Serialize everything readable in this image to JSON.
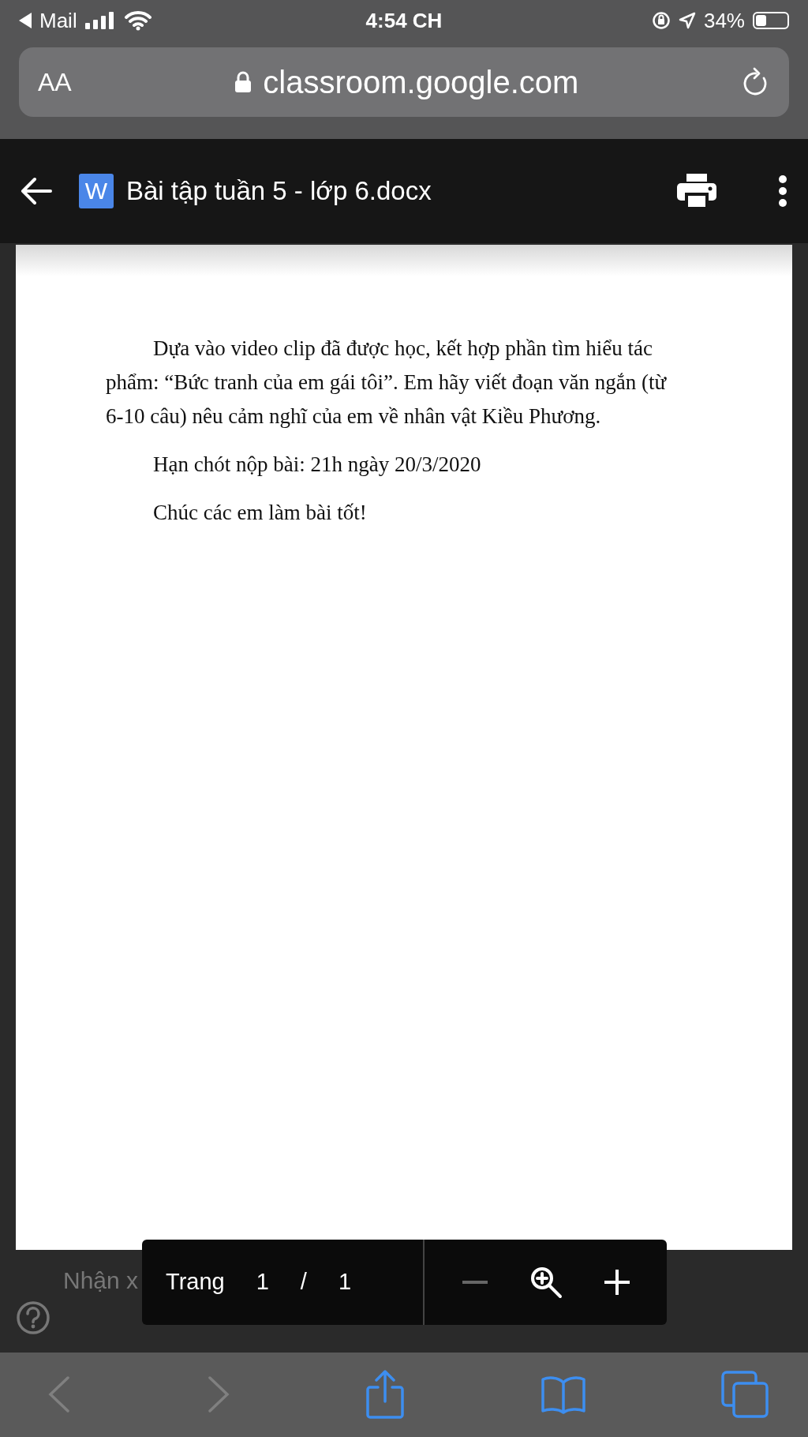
{
  "status_bar": {
    "back_app": "Mail",
    "time": "4:54 CH",
    "battery": "34%"
  },
  "url_bar": {
    "text_size": "AA",
    "url": "classroom.google.com"
  },
  "header": {
    "file_title": "Bài tập tuần 5 - lớp 6.docx",
    "app_badge": "W"
  },
  "document": {
    "paragraphs": [
      "Dựa vào video clip đã được học, kết hợp phần tìm hiểu tác phẩm: “Bức tranh của em gái tôi”. Em hãy viết đoạn văn ngắn (từ 6-10 câu) nêu cảm nghĩ của em về nhân vật Kiều Phương.",
      "Hạn chót nộp bài: 21h ngày 20/3/2020",
      "Chúc các em làm bài tốt!"
    ]
  },
  "background_label": "Nhận x",
  "page_toolbar": {
    "label": "Trang",
    "current_page": "1",
    "separator": "/",
    "total_pages": "1",
    "controls": [
      {
        "kind": "zoom-out",
        "disabled": true
      },
      {
        "kind": "zoom",
        "disabled": false
      },
      {
        "kind": "zoom-in",
        "disabled": false
      }
    ]
  },
  "browser_toolbar": [
    {
      "kind": "back",
      "disabled": true
    },
    {
      "kind": "forward",
      "disabled": true
    },
    {
      "kind": "share",
      "disabled": false
    },
    {
      "kind": "bookmarks",
      "disabled": false
    },
    {
      "kind": "tabs",
      "disabled": false
    }
  ]
}
